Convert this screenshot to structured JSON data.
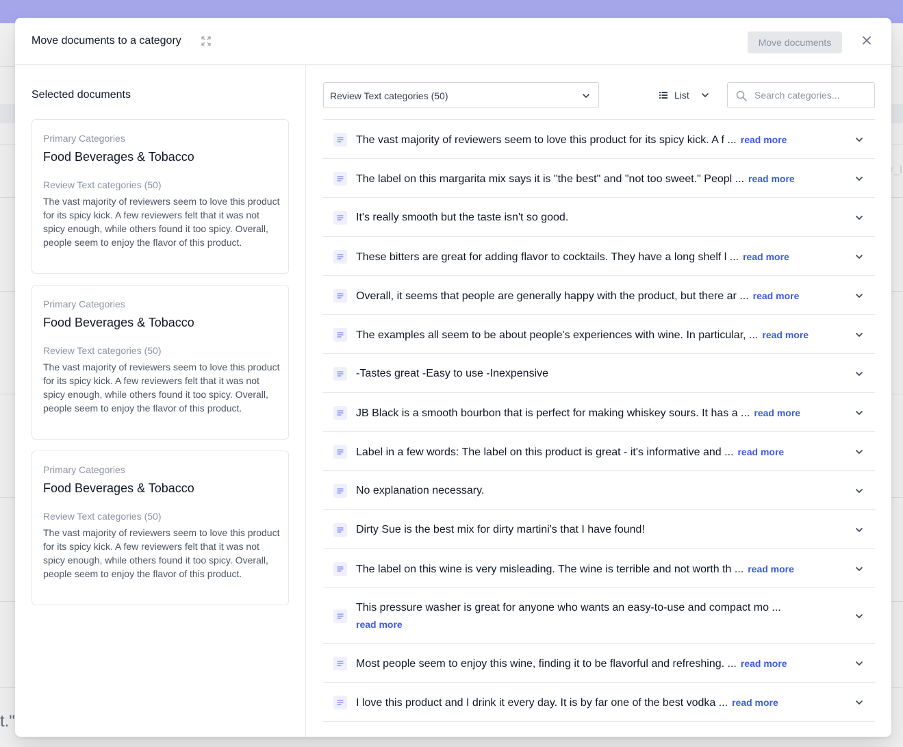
{
  "background": {
    "quote_fragment": "t.\"",
    "right_fragment": "r_l"
  },
  "modal": {
    "title": "Move documents to a category",
    "move_button": "Move documents",
    "icons": {
      "expand": "expand-arrows-icon",
      "close": "close-icon"
    }
  },
  "selected": {
    "heading": "Selected documents",
    "cards": [
      {
        "primary_label": "Primary Categories",
        "primary_value": "Food Beverages & Tobacco",
        "review_label": "Review Text categories (50)",
        "review_text": "The vast majority of reviewers seem to love this product for its spicy kick. A few reviewers felt that it was not spicy enough, while others found it too spicy. Overall, people seem to enjoy the flavor of this product."
      },
      {
        "primary_label": "Primary Categories",
        "primary_value": "Food Beverages & Tobacco",
        "review_label": "Review Text categories (50)",
        "review_text": "The vast majority of reviewers seem to love this product for its spicy kick. A few reviewers felt that it was not spicy enough, while others found it too spicy. Overall, people seem to enjoy the flavor of this product."
      },
      {
        "primary_label": "Primary Categories",
        "primary_value": "Food Beverages & Tobacco",
        "review_label": "Review Text categories (50)",
        "review_text": "The vast majority of reviewers seem to love this product for its spicy kick. A few reviewers felt that it was not spicy enough, while others found it too spicy. Overall, people seem to enjoy the flavor of this product."
      }
    ]
  },
  "categories": {
    "select_value": "Review Text categories (50)",
    "view_label": "List",
    "search_placeholder": "Search categories...",
    "read_more_label": "read more",
    "items": [
      {
        "text": "The vast majority of reviewers seem to love this product for its spicy kick. A f ...",
        "read_more": true
      },
      {
        "text": "The label on this margarita mix says it is \"the best\" and \"not too sweet.\" Peopl ...",
        "read_more": true
      },
      {
        "text": "It's really smooth but the taste isn't so good.",
        "read_more": false
      },
      {
        "text": "These bitters are great for adding flavor to cocktails. They have a long shelf l ...",
        "read_more": true
      },
      {
        "text": "Overall, it seems that people are generally happy with the product, but there ar ...",
        "read_more": true
      },
      {
        "text": "The examples all seem to be about people's experiences with wine. In particular, ...",
        "read_more": true
      },
      {
        "text": "-Tastes great -Easy to use -Inexpensive",
        "read_more": false
      },
      {
        "text": "JB Black is a smooth bourbon that is perfect for making whiskey sours. It has a ...",
        "read_more": true
      },
      {
        "text": "Label in a few words: The label on this product is great - it's informative and ...",
        "read_more": true
      },
      {
        "text": "No explanation necessary.",
        "read_more": false
      },
      {
        "text": "Dirty Sue is the best mix for dirty martini's that I have found!",
        "read_more": false
      },
      {
        "text": "The label on this wine is very misleading. The wine is terrible and not worth th ...",
        "read_more": true
      },
      {
        "text": "This pressure washer is great for anyone who wants an easy-to-use and compact mo ...",
        "read_more": true,
        "wrapped": true
      },
      {
        "text": "Most people seem to enjoy this wine, finding it to be flavorful and refreshing. ...",
        "read_more": true
      },
      {
        "text": "I love this product and I drink it every day. It is by far one of the best vodka ...",
        "read_more": true
      }
    ]
  }
}
